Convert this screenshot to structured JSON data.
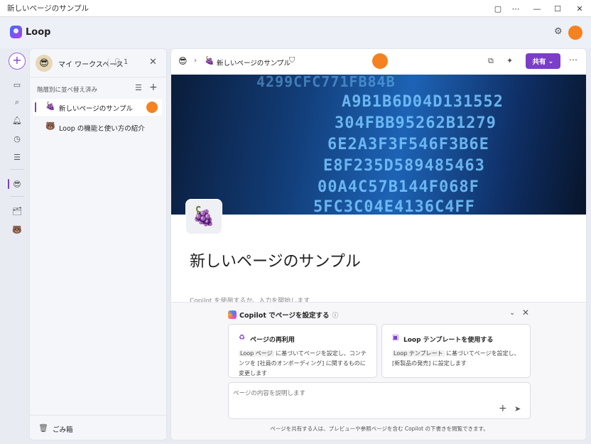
{
  "window": {
    "title": "新しいページのサンプル",
    "controls": [
      "▢",
      "⋯",
      "—",
      "☐",
      "✕"
    ]
  },
  "app": {
    "name": "Loop"
  },
  "workspace": {
    "name": "マイ ワークスペース",
    "member_count": "1",
    "sort_label": "階層別に並べ替え済み",
    "pages": [
      {
        "icon": "🍇",
        "label": "新しいページのサンプル",
        "active": true
      },
      {
        "icon": "🐻",
        "label": "Loop の機能と使い方の紹介",
        "active": false
      }
    ],
    "trash_label": "ごみ箱"
  },
  "toolbar": {
    "breadcrumb_workspace_icon": "😎",
    "breadcrumb_chevron": "›",
    "breadcrumb_page_icon": "🍇",
    "breadcrumb_page": "新しいページのサンプル",
    "share_label": "共有"
  },
  "banner": {
    "lines": [
      "4299CFC771FB84B",
      "A9B1B6D04D131552",
      "304FBB95262B1279",
      "6E2A3F3F546F3B6E",
      "E8F235D589485463",
      "00A4C57B144F068F",
      "5FC3C04E4136C4FF"
    ]
  },
  "page": {
    "icon": "🍇",
    "title": "新しいページのサンプル",
    "hint": "Copilot を使用するか、入力を開始します"
  },
  "copilot": {
    "title": "Copilot でページを設定する",
    "cards": [
      {
        "title": "ページの再利用",
        "tag": "Loop ページ",
        "desc": " に基づいてページを設定し、コンテンツを [社員のオンボーディング] に関するものに変更します"
      },
      {
        "title": "Loop テンプレートを使用する",
        "tag": "Loop テンプレート",
        "desc": " に基づいてページを設定し、[新製品の発売] に設定します"
      }
    ],
    "input_placeholder": "ページの内容を説明します",
    "footer": "ページを共有する人は、プレビューや参照ページを含む Copilot の下書きを閲覧できます。"
  },
  "colors": {
    "accent": "#7a3ec8",
    "presence": "#f58220"
  }
}
